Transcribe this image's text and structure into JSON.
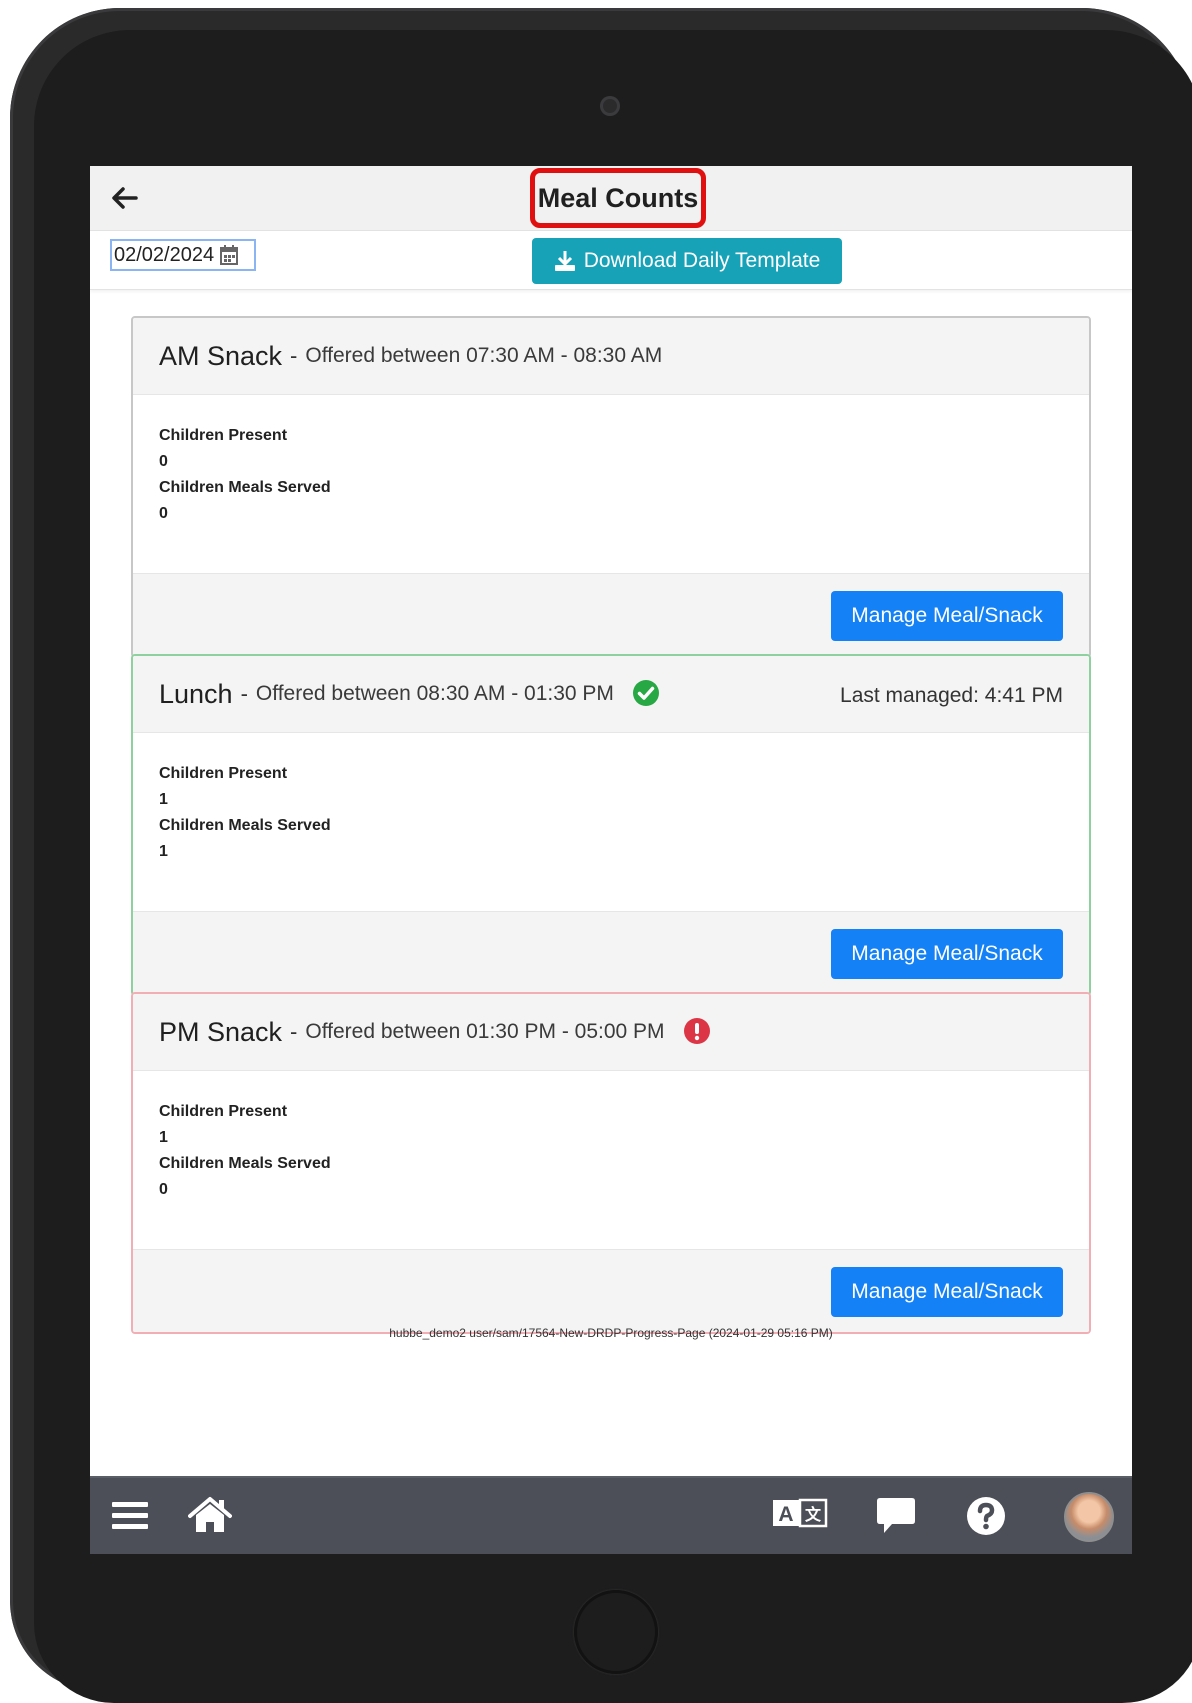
{
  "header": {
    "title": "Meal Counts",
    "date_value": "02/02/2024",
    "download_label": "Download Daily Template"
  },
  "meals": [
    {
      "name": "AM Snack",
      "offered": "Offered between 07:30 AM - 08:30 AM",
      "status": "none",
      "children_present_label": "Children Present",
      "children_present": "0",
      "meals_served_label": "Children Meals Served",
      "meals_served": "0",
      "manage_label": "Manage Meal/Snack"
    },
    {
      "name": "Lunch",
      "offered": "Offered between 08:30 AM - 01:30 PM",
      "status": "complete",
      "last_managed": "Last managed: 4:41 PM",
      "children_present_label": "Children Present",
      "children_present": "1",
      "meals_served_label": "Children Meals Served",
      "meals_served": "1",
      "manage_label": "Manage Meal/Snack"
    },
    {
      "name": "PM Snack",
      "offered": "Offered between 01:30 PM - 05:00 PM",
      "status": "alert",
      "children_present_label": "Children Present",
      "children_present": "1",
      "meals_served_label": "Children Meals Served",
      "meals_served": "0",
      "manage_label": "Manage Meal/Snack"
    }
  ],
  "version_text": "hubbe_demo2 user/sam/17564-New-DRDP-Progress-Page (2024-01-29 05:16 PM)",
  "colors": {
    "accent_blue": "#1481f6",
    "teal": "#17a2b8",
    "success": "#28a745",
    "danger": "#dc3545",
    "highlight": "#e01010"
  },
  "icons": {
    "back": "arrow-left-icon",
    "calendar": "calendar-icon",
    "download": "download-icon",
    "complete": "check-circle-icon",
    "alert": "exclamation-circle-icon",
    "menu": "hamburger-menu-icon",
    "home": "home-icon",
    "translate": "translate-icon",
    "chat": "chat-bubble-icon",
    "help": "question-circle-icon"
  }
}
